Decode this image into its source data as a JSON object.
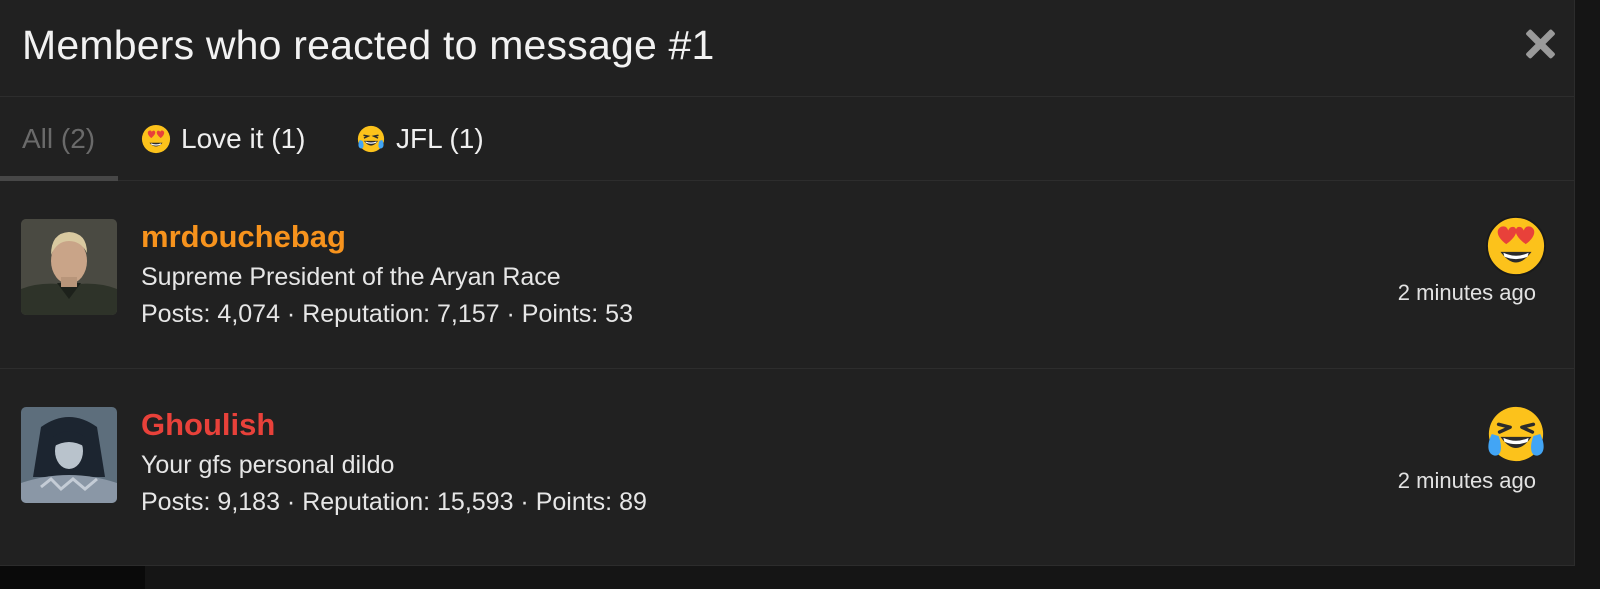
{
  "dialog": {
    "title": "Members who reacted to message #1",
    "close_icon": "close-icon"
  },
  "tabs": [
    {
      "label": "All (2)",
      "icon": null,
      "active": true
    },
    {
      "label": "Love it (1)",
      "icon": "heart-eyes-emoji-icon",
      "active": false
    },
    {
      "label": "JFL (1)",
      "icon": "tears-of-joy-emoji-icon",
      "active": false
    }
  ],
  "members": [
    {
      "username": "mrdouchebag",
      "username_color": "#f7931d",
      "user_title": "Supreme President of the Aryan Race",
      "stats": "Posts: 4,074 · Reputation: 7,157 · Points: 53",
      "reaction_icon": "heart-eyes-emoji-icon",
      "time": "2 minutes ago"
    },
    {
      "username": "Ghoulish",
      "username_color": "#e8413a",
      "user_title": "Your gfs personal dildo",
      "stats": "Posts: 9,183 · Reputation: 15,593 · Points: 89",
      "reaction_icon": "tears-of-joy-emoji-icon",
      "time": "2 minutes ago"
    }
  ]
}
